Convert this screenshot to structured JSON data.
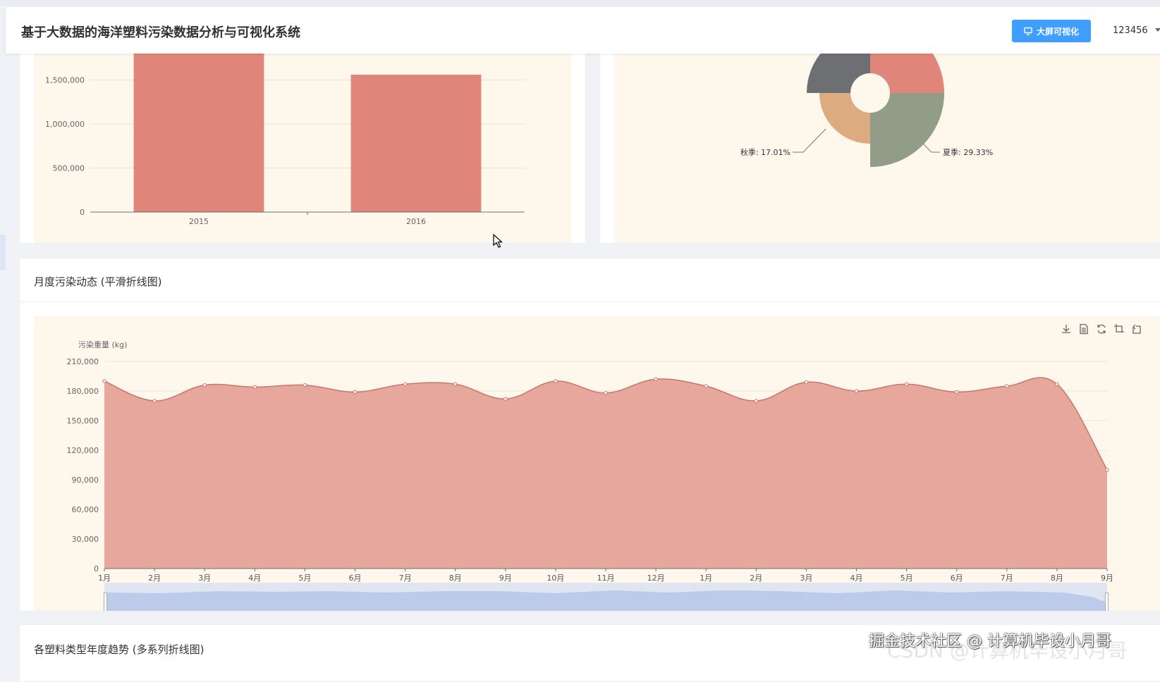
{
  "header": {
    "title": "基于大数据的海洋塑料污染数据分析与可视化系统",
    "bigscreen_label": "大屏可视化",
    "username": "123456"
  },
  "cards": {
    "monthly_title": "月度污染动态 (平滑折线图)",
    "types_title": "各塑料类型年度趋势 (多系列折线图)"
  },
  "toolbox": [
    "download-icon",
    "dataview-icon",
    "refresh-icon",
    "zoom-icon",
    "zoom-reset-icon"
  ],
  "watermark": {
    "primary": "掘金技术社区 @ 计算机毕设小月哥",
    "secondary": "CSDN @计算机毕设小月哥"
  },
  "colors": {
    "bar": "#df8579",
    "area_fill": "#e7a79d",
    "area_line": "#c9756a",
    "chart_bg": "#fdf7ec",
    "primary_button": "#409eff"
  },
  "chart_data": [
    {
      "type": "bar",
      "categories": [
        "2015",
        "2016"
      ],
      "values": [
        1950000,
        1560000
      ],
      "ytick_labels": [
        "0",
        "500,000",
        "1,000,000",
        "1,500,000"
      ],
      "ylim": [
        0,
        2000000
      ]
    },
    {
      "type": "pie",
      "slices": [
        {
          "name": "秋季",
          "percent": 17.01,
          "label": "秋季: 17.01%",
          "color": "#dcab80"
        },
        {
          "name": "夏季",
          "percent": 29.33,
          "label": "夏季: 29.33%",
          "color": "#929d88"
        },
        {
          "name": "",
          "percent": null,
          "label": "",
          "color": "#df8579"
        },
        {
          "name": "",
          "percent": null,
          "label": "",
          "color": "#6e6f73"
        }
      ]
    },
    {
      "type": "area",
      "ylabel": "污染重量 (kg)",
      "categories": [
        "1月",
        "2月",
        "3月",
        "4月",
        "5月",
        "6月",
        "7月",
        "8月",
        "9月",
        "10月",
        "11月",
        "12月",
        "1月",
        "2月",
        "3月",
        "4月",
        "5月",
        "6月",
        "7月",
        "8月",
        "9月"
      ],
      "values": [
        190000,
        170000,
        186000,
        184000,
        186000,
        179000,
        187000,
        187000,
        172000,
        190000,
        178000,
        192000,
        185000,
        170000,
        189000,
        180000,
        187000,
        179000,
        185000,
        187000,
        100000
      ],
      "ytick_labels": [
        "0",
        "30,000",
        "60,000",
        "90,000",
        "120,000",
        "150,000",
        "180,000",
        "210,000"
      ],
      "ylim": [
        0,
        210000
      ]
    }
  ]
}
